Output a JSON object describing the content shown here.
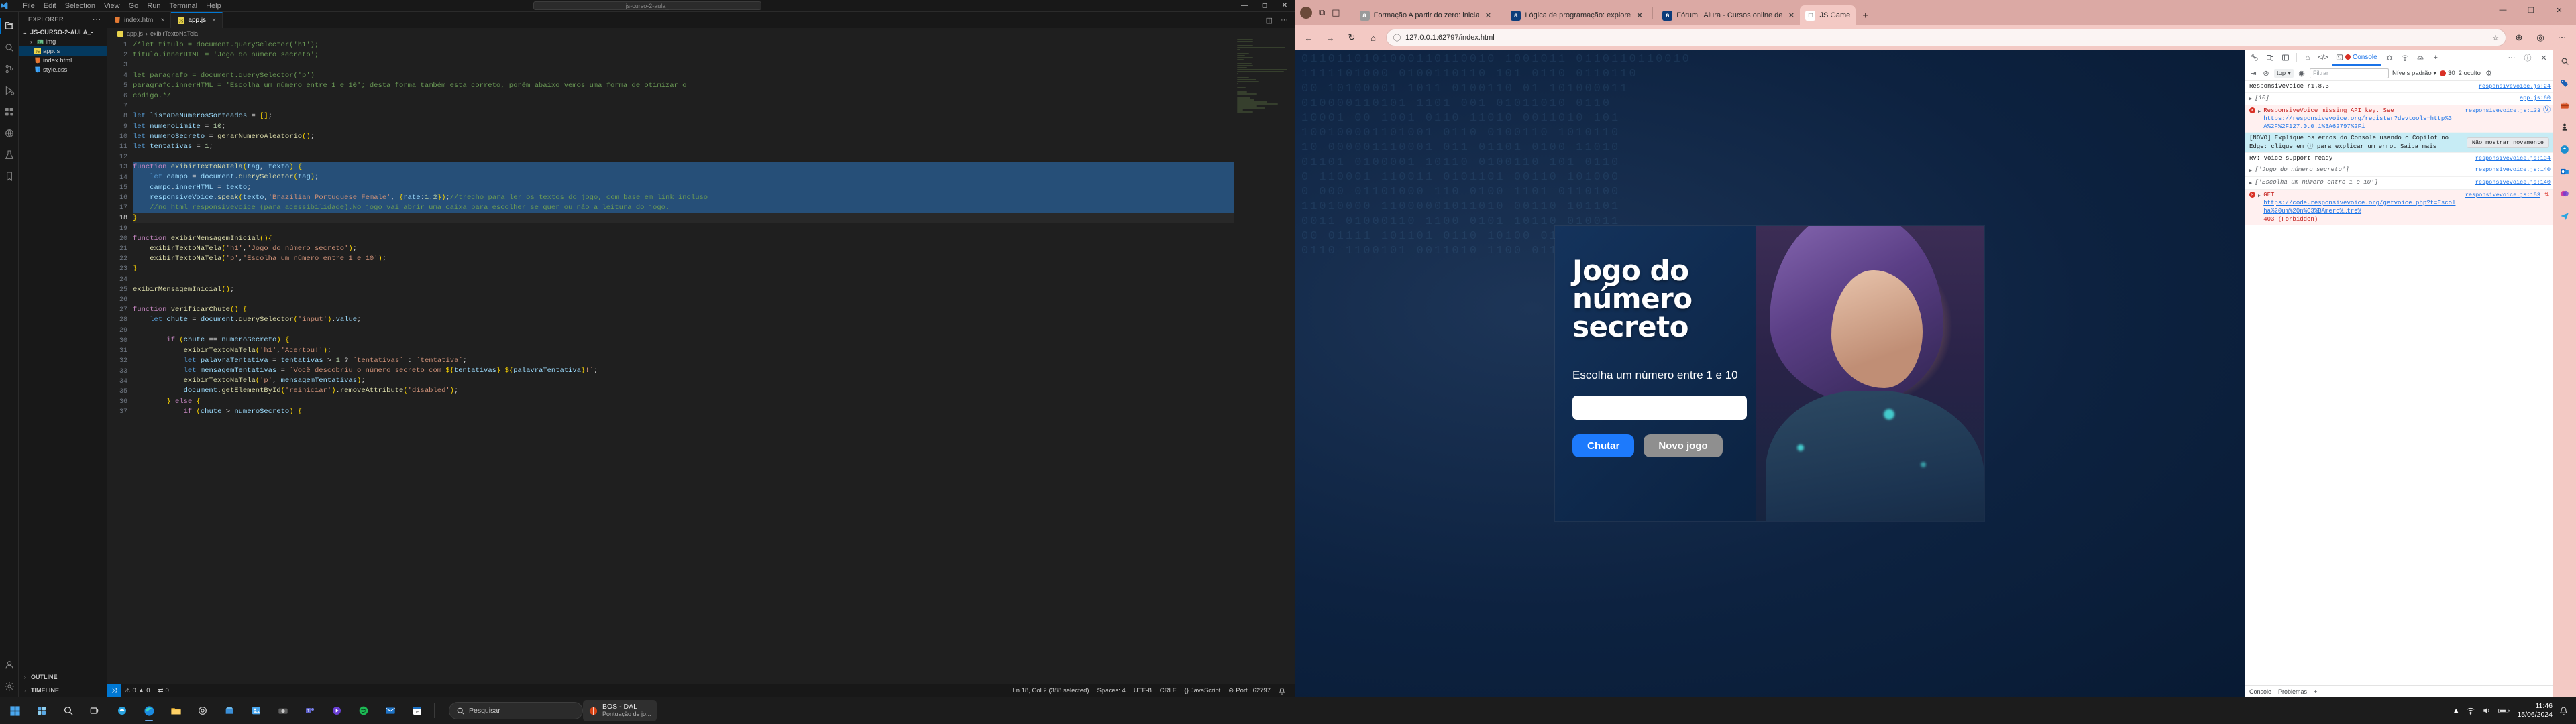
{
  "vscode": {
    "menus": [
      "File",
      "Edit",
      "Selection",
      "View",
      "Go",
      "Run",
      "Terminal",
      "Help"
    ],
    "search_placeholder": "js-curso-2-aula_",
    "explorer_title": "EXPLORER",
    "explorer_overflow": "···",
    "tree": [
      {
        "label": "JS-CURSO-2-AULA_-",
        "type": "root",
        "twisty": "⌄",
        "icon": ""
      },
      {
        "label": "img",
        "type": "folder",
        "twisty": "›",
        "icon": "🖼"
      },
      {
        "label": "app.js",
        "type": "file-js",
        "twisty": "",
        "icon": "JS",
        "selected": true
      },
      {
        "label": "index.html",
        "type": "file-html",
        "twisty": "",
        "icon": "◇"
      },
      {
        "label": "style.css",
        "type": "file-css",
        "twisty": "",
        "icon": "#"
      }
    ],
    "sections": [
      "OUTLINE",
      "TIMELINE"
    ],
    "tabs": [
      {
        "label": "index.html",
        "icon": "◇",
        "icon_color": "#e37933",
        "active": false,
        "close": "×"
      },
      {
        "label": "app.js",
        "icon": "JS",
        "icon_color": "#e9d44d",
        "active": true,
        "close": "×"
      }
    ],
    "breadcrumb": [
      "app.js",
      "exibirTextoNaTela"
    ],
    "code_lines": [
      {
        "n": 1,
        "html": "<span class=\"cmt\">/*let titulo = document.querySelector('h1');</span>"
      },
      {
        "n": 2,
        "html": "<span class=\"cmt\">titulo.innerHTML = 'Jogo do número secreto';</span>"
      },
      {
        "n": 3,
        "html": ""
      },
      {
        "n": 4,
        "html": "<span class=\"cmt\">let paragrafo = document.querySelector('p')</span>"
      },
      {
        "n": 5,
        "html": "<span class=\"cmt\">paragrafo.innerHTML = 'Escolha um número entre 1 e 10'; desta forma também esta correto, porém abaixo vemos uma forma de otimizar o</span>"
      },
      {
        "n": 6,
        "html": "<span class=\"cmt\">código.*/</span>"
      },
      {
        "n": 7,
        "html": ""
      },
      {
        "n": 8,
        "html": "<span class=\"kw\">let</span> <span class=\"var\">listaDeNumerosSorteados</span> <span class=\"op\">=</span> <span class=\"br\">[]</span><span class=\"op\">;</span>"
      },
      {
        "n": 9,
        "html": "<span class=\"kw\">let</span> <span class=\"var\">numeroLimite</span> <span class=\"op\">=</span> <span class=\"num\">10</span><span class=\"op\">;</span>"
      },
      {
        "n": 10,
        "html": "<span class=\"kw\">let</span> <span class=\"var\">numeroSecreto</span> <span class=\"op\">=</span> <span class=\"fn\">gerarNumeroAleatorio</span><span class=\"br\">()</span><span class=\"op\">;</span>"
      },
      {
        "n": 11,
        "html": "<span class=\"kw\">let</span> <span class=\"var\">tentativas</span> <span class=\"op\">=</span> <span class=\"num\">1</span><span class=\"op\">;</span>"
      },
      {
        "n": 12,
        "html": ""
      },
      {
        "n": 13,
        "html": "<span class=\"kw2\">function</span> <span class=\"fn\">exibirTextoNaTela</span><span class=\"br\">(</span><span class=\"var\">tag</span><span class=\"op\">,</span> <span class=\"var\">texto</span><span class=\"br\">)</span> <span class=\"br\">{</span>",
        "sel": true
      },
      {
        "n": 14,
        "html": "    <span class=\"kw\">let</span> <span class=\"var\">campo</span> <span class=\"op\">=</span> <span class=\"var\">document</span><span class=\"op\">.</span><span class=\"fn\">querySelector</span><span class=\"br\">(</span><span class=\"var\">tag</span><span class=\"br\">)</span><span class=\"op\">;</span>",
        "sel": true
      },
      {
        "n": 15,
        "html": "    <span class=\"var\">campo</span><span class=\"op\">.</span><span class=\"prop\">innerHTML</span> <span class=\"op\">=</span> <span class=\"var\">texto</span><span class=\"op\">;</span>",
        "sel": true
      },
      {
        "n": 16,
        "html": "    <span class=\"var\">responsiveVoice</span><span class=\"op\">.</span><span class=\"fn\">speak</span><span class=\"br\">(</span><span class=\"var\">texto</span><span class=\"op\">,</span><span class=\"str\">'Brazilian Portuguese Female'</span><span class=\"op\">,</span> <span class=\"br\">{</span><span class=\"prop\">rate</span><span class=\"op\">:</span><span class=\"num\">1.2</span><span class=\"br\">}</span><span class=\"br\">)</span><span class=\"op\">;</span><span class=\"cmt\">//trecho para ler os textos do jogo, com base em link incluso</span>",
        "sel": true
      },
      {
        "n": 17,
        "html": "    <span class=\"cmt\">//no html responsivevoice (para acessibilidade).No jogo vai abrir uma caixa para escolher se quer ou não a leitura do jogo.</span>",
        "sel": true
      },
      {
        "n": 18,
        "html": "<span class=\"br\">}</span>",
        "cur": true
      },
      {
        "n": 19,
        "html": ""
      },
      {
        "n": 20,
        "html": "<span class=\"kw2\">function</span> <span class=\"fn\">exibirMensagemInicial</span><span class=\"br\">()</span><span class=\"br\">{</span>"
      },
      {
        "n": 21,
        "html": "    <span class=\"fn\">exibirTextoNaTela</span><span class=\"br\">(</span><span class=\"str\">'h1'</span><span class=\"op\">,</span><span class=\"str\">'Jogo do número secreto'</span><span class=\"br\">)</span><span class=\"op\">;</span>"
      },
      {
        "n": 22,
        "html": "    <span class=\"fn\">exibirTextoNaTela</span><span class=\"br\">(</span><span class=\"str\">'p'</span><span class=\"op\">,</span><span class=\"str\">'Escolha um número entre 1 e 10'</span><span class=\"br\">)</span><span class=\"op\">;</span>"
      },
      {
        "n": 23,
        "html": "<span class=\"br\">}</span>"
      },
      {
        "n": 24,
        "html": ""
      },
      {
        "n": 25,
        "html": "<span class=\"fn\">exibirMensagemInicial</span><span class=\"br\">()</span><span class=\"op\">;</span>"
      },
      {
        "n": 26,
        "html": ""
      },
      {
        "n": 27,
        "html": "<span class=\"kw2\">function</span> <span class=\"fn\">verificarChute</span><span class=\"br\">()</span> <span class=\"br\">{</span>"
      },
      {
        "n": 28,
        "html": "    <span class=\"kw\">let</span> <span class=\"var\">chute</span> <span class=\"op\">=</span> <span class=\"var\">document</span><span class=\"op\">.</span><span class=\"fn\">querySelector</span><span class=\"br\">(</span><span class=\"str\">'input'</span><span class=\"br\">)</span><span class=\"op\">.</span><span class=\"prop\">value</span><span class=\"op\">;</span>"
      },
      {
        "n": 29,
        "html": ""
      },
      {
        "n": 30,
        "html": "        <span class=\"kw2\">if</span> <span class=\"br\">(</span><span class=\"var\">chute</span> <span class=\"op\">==</span> <span class=\"var\">numeroSecreto</span><span class=\"br\">)</span> <span class=\"br\">{</span>"
      },
      {
        "n": 31,
        "html": "            <span class=\"fn\">exibirTextoNaTela</span><span class=\"br\">(</span><span class=\"str\">'h1'</span><span class=\"op\">,</span><span class=\"str\">'Acertou!'</span><span class=\"br\">)</span><span class=\"op\">;</span>"
      },
      {
        "n": 32,
        "html": "            <span class=\"kw\">let</span> <span class=\"var\">palavraTentativa</span> <span class=\"op\">=</span> <span class=\"var\">tentativas</span> <span class=\"op\">&gt;</span> <span class=\"num\">1</span> <span class=\"op\">?</span> <span class=\"str\">`tentativas`</span> <span class=\"op\">:</span> <span class=\"str\">`tentativa`</span><span class=\"op\">;</span>"
      },
      {
        "n": 33,
        "html": "            <span class=\"kw\">let</span> <span class=\"var\">mensagemTentativas</span> <span class=\"op\">=</span> <span class=\"str\">`Você descobriu o número secreto com <span class=\"br\">${</span><span class=\"var\">tentativas</span><span class=\"br\">}</span> <span class=\"br\">${</span><span class=\"var\">palavraTentativa</span><span class=\"br\">}</span>!`</span><span class=\"op\">;</span>"
      },
      {
        "n": 34,
        "html": "            <span class=\"fn\">exibirTextoNaTela</span><span class=\"br\">(</span><span class=\"str\">'p'</span><span class=\"op\">,</span> <span class=\"var\">mensagemTentativas</span><span class=\"br\">)</span><span class=\"op\">;</span>"
      },
      {
        "n": 35,
        "html": "            <span class=\"var\">document</span><span class=\"op\">.</span><span class=\"fn\">getElementById</span><span class=\"br\">(</span><span class=\"str\">'reiniciar'</span><span class=\"br\">)</span><span class=\"op\">.</span><span class=\"fn\">removeAttribute</span><span class=\"br\">(</span><span class=\"str\">'disabled'</span><span class=\"br\">)</span><span class=\"op\">;</span>"
      },
      {
        "n": 36,
        "html": "        <span class=\"br\">}</span> <span class=\"kw2\">else</span> <span class=\"br\">{</span>"
      },
      {
        "n": 37,
        "html": "            <span class=\"kw2\">if</span> <span class=\"br\">(</span><span class=\"var\">chute</span> <span class=\"op\">&gt;</span> <span class=\"var\">numeroSecreto</span><span class=\"br\">)</span> <span class=\"br\">{</span>"
      }
    ],
    "statusbar": {
      "remote": "⤨",
      "errors": "0",
      "warnings": "0",
      "ports": "0",
      "cursor": "Ln 18, Col 2 (388 selected)",
      "spaces": "Spaces: 4",
      "encoding": "UTF-8",
      "eol": "CRLF",
      "language": "JavaScript",
      "port": "Port : 62797",
      "bell": "🔔"
    }
  },
  "browser": {
    "tabs": [
      {
        "label": "Formação A partir do zero: inicia",
        "favicon": "a",
        "favicon_bg": "#9a9a9a",
        "active": false
      },
      {
        "label": "Lógica de programação: explore",
        "favicon": "a",
        "favicon_bg": "#0b3b7a",
        "active": false
      },
      {
        "label": "Fórum | Alura - Cursos online de",
        "favicon": "a",
        "favicon_bg": "#0b3b7a",
        "active": false
      },
      {
        "label": "JS Game",
        "favicon": "□",
        "favicon_bg": "#ffffff",
        "active": true
      }
    ],
    "new_tab": "+",
    "window_controls": [
      "—",
      "❐",
      "✕"
    ],
    "toolbar": {
      "back": "←",
      "forward": "→",
      "reload": "↻",
      "home": "⌂",
      "url": "127.0.0.1:62797/index.html",
      "favorite": "☆",
      "collections": "⊕",
      "profile": "◎",
      "settings": "⋯"
    },
    "sidepanel_icons": [
      "search-icon",
      "tag-icon",
      "toolbox-icon",
      "pawn-icon",
      "copilot-icon",
      "outlook-icon",
      "designer-icon",
      "telegram-icon"
    ]
  },
  "game": {
    "title": "Jogo do número secreto",
    "subtitle": "Escolha um número entre 1 e 10",
    "input_value": "",
    "input_placeholder": "",
    "primary_button": "Chutar",
    "secondary_button": "Novo jogo",
    "colors": {
      "primary": "#1d7afc",
      "secondary": "#8f8f8f",
      "bg": "#0c2444"
    }
  },
  "devtools": {
    "tabs": [
      {
        "label": "Elementos",
        "icon": "‹›",
        "active": false,
        "icon_only": true
      },
      {
        "label": "Console",
        "icon": "❯_",
        "active": true,
        "error_badge": true
      }
    ],
    "left_icons": [
      "inspect-icon",
      "device-toggle-icon",
      "panel-layout-icon"
    ],
    "extra_icons": [
      "home-icon",
      "sources-icon",
      "bug-icon",
      "network-icon",
      "performance-icon",
      "add-panel-icon"
    ],
    "right_icons": [
      "more-icon",
      "help-icon",
      "close-icon"
    ],
    "filterbar": {
      "sidebar_toggle": "⇥",
      "clear": "⊘",
      "context": "top",
      "eye": "◉",
      "filter_placeholder": "Filtrar",
      "levels": "Níveis padrão",
      "error_count": "30",
      "hidden": "2 oculto",
      "settings": "⚙"
    },
    "messages": [
      {
        "kind": "info",
        "text": "ResponsiveVoice r1.8.3",
        "source": "responsivevoice.js:24"
      },
      {
        "kind": "group",
        "text": "[10]",
        "source": "app.js:60",
        "italic": true
      },
      {
        "kind": "error",
        "text": "ResponsiveVoice missing API key. See",
        "source": "responsivevoice.js:133",
        "link": "https://responsivevoice.org/register?devtools=http%3A%2F%2F127.0.0.1%3A62797%2Fi",
        "copilot": true
      },
      {
        "kind": "banner",
        "text": "[NOVO] Explique os erros do Console usando o Copilot no Edge: clique em ⓘ para explicar um erro.",
        "link_text": "Saiba mais",
        "button": "Não mostrar novamente"
      },
      {
        "kind": "info",
        "text": "RV: Voice support ready",
        "source": "responsivevoice.js:134"
      },
      {
        "kind": "group",
        "text": "['Jogo do número secreto']",
        "source": "responsivevoice.js:140",
        "italic": true
      },
      {
        "kind": "group",
        "text": "['Escolha um número entre 1 e 10']",
        "source": "responsivevoice.js:140",
        "italic": true
      },
      {
        "kind": "error",
        "text": "GET",
        "source": "responsivevoice.js:153",
        "link": "https://code.responsivevoice.org/getvoice.php?t=Escolha%20um%20n%C3%BAmero%…tre%",
        "suffix": "403 (Forbidden)",
        "copilot": true
      }
    ],
    "bottom": {
      "console": "Console",
      "problems": "Problemas",
      "add": "+"
    }
  },
  "taskbar": {
    "start": "⊞",
    "pinned": [
      "widgets-icon",
      "search-icon",
      "taskview-icon",
      "copilot-icon",
      "edge-icon",
      "explorer-icon",
      "settings-icon",
      "store-icon",
      "photos-icon",
      "camera-icon",
      "teams-icon",
      "clipchamp-icon",
      "spotify-icon",
      "mail-icon",
      "calendar-icon"
    ],
    "search_placeholder": "Pesquisar",
    "apps": [
      {
        "title": "BOS - DAL",
        "subtitle": "Pontuação de jo...",
        "active": true
      },
      {
        "title": "",
        "subtitle": "",
        "active": false
      }
    ],
    "tray": [
      "chevron-up-icon",
      "network-icon",
      "volume-icon",
      "battery-icon"
    ],
    "clock_time": "11:46",
    "clock_date": "15/06/2024",
    "vscode_status_time": "11:46",
    "code_date": "15/06/2024"
  }
}
